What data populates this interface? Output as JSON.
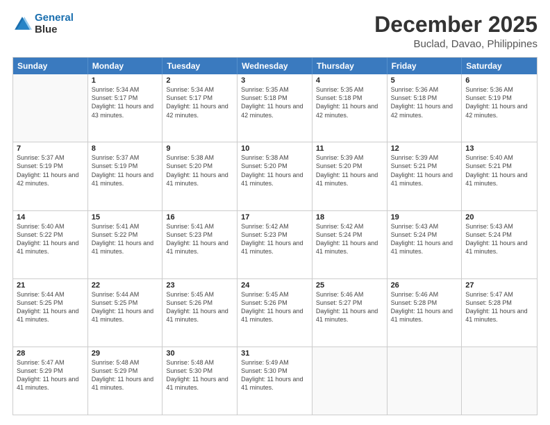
{
  "logo": {
    "line1": "General",
    "line2": "Blue"
  },
  "header": {
    "month_year": "December 2025",
    "location": "Buclad, Davao, Philippines"
  },
  "days_of_week": [
    "Sunday",
    "Monday",
    "Tuesday",
    "Wednesday",
    "Thursday",
    "Friday",
    "Saturday"
  ],
  "weeks": [
    [
      {
        "day": "",
        "sunrise": "",
        "sunset": "",
        "daylight": ""
      },
      {
        "day": "1",
        "sunrise": "Sunrise: 5:34 AM",
        "sunset": "Sunset: 5:17 PM",
        "daylight": "Daylight: 11 hours and 43 minutes."
      },
      {
        "day": "2",
        "sunrise": "Sunrise: 5:34 AM",
        "sunset": "Sunset: 5:17 PM",
        "daylight": "Daylight: 11 hours and 42 minutes."
      },
      {
        "day": "3",
        "sunrise": "Sunrise: 5:35 AM",
        "sunset": "Sunset: 5:18 PM",
        "daylight": "Daylight: 11 hours and 42 minutes."
      },
      {
        "day": "4",
        "sunrise": "Sunrise: 5:35 AM",
        "sunset": "Sunset: 5:18 PM",
        "daylight": "Daylight: 11 hours and 42 minutes."
      },
      {
        "day": "5",
        "sunrise": "Sunrise: 5:36 AM",
        "sunset": "Sunset: 5:18 PM",
        "daylight": "Daylight: 11 hours and 42 minutes."
      },
      {
        "day": "6",
        "sunrise": "Sunrise: 5:36 AM",
        "sunset": "Sunset: 5:19 PM",
        "daylight": "Daylight: 11 hours and 42 minutes."
      }
    ],
    [
      {
        "day": "7",
        "sunrise": "Sunrise: 5:37 AM",
        "sunset": "Sunset: 5:19 PM",
        "daylight": "Daylight: 11 hours and 42 minutes."
      },
      {
        "day": "8",
        "sunrise": "Sunrise: 5:37 AM",
        "sunset": "Sunset: 5:19 PM",
        "daylight": "Daylight: 11 hours and 41 minutes."
      },
      {
        "day": "9",
        "sunrise": "Sunrise: 5:38 AM",
        "sunset": "Sunset: 5:20 PM",
        "daylight": "Daylight: 11 hours and 41 minutes."
      },
      {
        "day": "10",
        "sunrise": "Sunrise: 5:38 AM",
        "sunset": "Sunset: 5:20 PM",
        "daylight": "Daylight: 11 hours and 41 minutes."
      },
      {
        "day": "11",
        "sunrise": "Sunrise: 5:39 AM",
        "sunset": "Sunset: 5:20 PM",
        "daylight": "Daylight: 11 hours and 41 minutes."
      },
      {
        "day": "12",
        "sunrise": "Sunrise: 5:39 AM",
        "sunset": "Sunset: 5:21 PM",
        "daylight": "Daylight: 11 hours and 41 minutes."
      },
      {
        "day": "13",
        "sunrise": "Sunrise: 5:40 AM",
        "sunset": "Sunset: 5:21 PM",
        "daylight": "Daylight: 11 hours and 41 minutes."
      }
    ],
    [
      {
        "day": "14",
        "sunrise": "Sunrise: 5:40 AM",
        "sunset": "Sunset: 5:22 PM",
        "daylight": "Daylight: 11 hours and 41 minutes."
      },
      {
        "day": "15",
        "sunrise": "Sunrise: 5:41 AM",
        "sunset": "Sunset: 5:22 PM",
        "daylight": "Daylight: 11 hours and 41 minutes."
      },
      {
        "day": "16",
        "sunrise": "Sunrise: 5:41 AM",
        "sunset": "Sunset: 5:23 PM",
        "daylight": "Daylight: 11 hours and 41 minutes."
      },
      {
        "day": "17",
        "sunrise": "Sunrise: 5:42 AM",
        "sunset": "Sunset: 5:23 PM",
        "daylight": "Daylight: 11 hours and 41 minutes."
      },
      {
        "day": "18",
        "sunrise": "Sunrise: 5:42 AM",
        "sunset": "Sunset: 5:24 PM",
        "daylight": "Daylight: 11 hours and 41 minutes."
      },
      {
        "day": "19",
        "sunrise": "Sunrise: 5:43 AM",
        "sunset": "Sunset: 5:24 PM",
        "daylight": "Daylight: 11 hours and 41 minutes."
      },
      {
        "day": "20",
        "sunrise": "Sunrise: 5:43 AM",
        "sunset": "Sunset: 5:24 PM",
        "daylight": "Daylight: 11 hours and 41 minutes."
      }
    ],
    [
      {
        "day": "21",
        "sunrise": "Sunrise: 5:44 AM",
        "sunset": "Sunset: 5:25 PM",
        "daylight": "Daylight: 11 hours and 41 minutes."
      },
      {
        "day": "22",
        "sunrise": "Sunrise: 5:44 AM",
        "sunset": "Sunset: 5:25 PM",
        "daylight": "Daylight: 11 hours and 41 minutes."
      },
      {
        "day": "23",
        "sunrise": "Sunrise: 5:45 AM",
        "sunset": "Sunset: 5:26 PM",
        "daylight": "Daylight: 11 hours and 41 minutes."
      },
      {
        "day": "24",
        "sunrise": "Sunrise: 5:45 AM",
        "sunset": "Sunset: 5:26 PM",
        "daylight": "Daylight: 11 hours and 41 minutes."
      },
      {
        "day": "25",
        "sunrise": "Sunrise: 5:46 AM",
        "sunset": "Sunset: 5:27 PM",
        "daylight": "Daylight: 11 hours and 41 minutes."
      },
      {
        "day": "26",
        "sunrise": "Sunrise: 5:46 AM",
        "sunset": "Sunset: 5:28 PM",
        "daylight": "Daylight: 11 hours and 41 minutes."
      },
      {
        "day": "27",
        "sunrise": "Sunrise: 5:47 AM",
        "sunset": "Sunset: 5:28 PM",
        "daylight": "Daylight: 11 hours and 41 minutes."
      }
    ],
    [
      {
        "day": "28",
        "sunrise": "Sunrise: 5:47 AM",
        "sunset": "Sunset: 5:29 PM",
        "daylight": "Daylight: 11 hours and 41 minutes."
      },
      {
        "day": "29",
        "sunrise": "Sunrise: 5:48 AM",
        "sunset": "Sunset: 5:29 PM",
        "daylight": "Daylight: 11 hours and 41 minutes."
      },
      {
        "day": "30",
        "sunrise": "Sunrise: 5:48 AM",
        "sunset": "Sunset: 5:30 PM",
        "daylight": "Daylight: 11 hours and 41 minutes."
      },
      {
        "day": "31",
        "sunrise": "Sunrise: 5:49 AM",
        "sunset": "Sunset: 5:30 PM",
        "daylight": "Daylight: 11 hours and 41 minutes."
      },
      {
        "day": "",
        "sunrise": "",
        "sunset": "",
        "daylight": ""
      },
      {
        "day": "",
        "sunrise": "",
        "sunset": "",
        "daylight": ""
      },
      {
        "day": "",
        "sunrise": "",
        "sunset": "",
        "daylight": ""
      }
    ]
  ]
}
